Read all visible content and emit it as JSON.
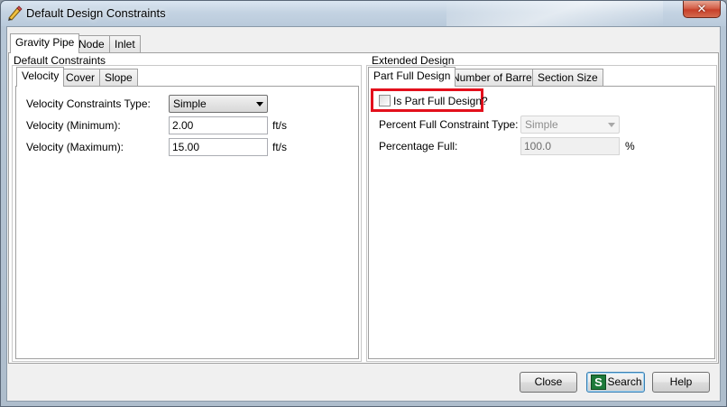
{
  "window": {
    "title": "Default Design Constraints",
    "close_glyph": "✕"
  },
  "top_tabs": [
    {
      "label": "Gravity Pipe",
      "active": true
    },
    {
      "label": "Node",
      "active": false
    },
    {
      "label": "Inlet",
      "active": false
    }
  ],
  "default_constraints": {
    "group_label": "Default Constraints",
    "tabs": [
      {
        "label": "Velocity",
        "active": true
      },
      {
        "label": "Cover",
        "active": false
      },
      {
        "label": "Slope",
        "active": false
      }
    ],
    "fields": {
      "type_label": "Velocity Constraints Type:",
      "type_value": "Simple",
      "min_label": "Velocity (Minimum):",
      "min_value": "2.00",
      "min_unit": "ft/s",
      "max_label": "Velocity (Maximum):",
      "max_value": "15.00",
      "max_unit": "ft/s"
    }
  },
  "extended_design": {
    "group_label": "Extended Design",
    "tabs": [
      {
        "label": "Part Full Design",
        "active": true
      },
      {
        "label": "Number of Barrels",
        "active": false
      },
      {
        "label": "Section Size",
        "active": false
      }
    ],
    "fields": {
      "is_part_full_label": "Is Part Full Design?",
      "is_part_full_checked": false,
      "percent_type_label": "Percent Full Constraint Type:",
      "percent_type_value": "Simple",
      "percentage_label": "Percentage Full:",
      "percentage_value": "100.0",
      "percentage_unit": "%"
    }
  },
  "footer": {
    "close_label": "Close",
    "search_label": "Search",
    "help_label": "Help"
  },
  "colors": {
    "highlight": "#e3101c",
    "search_icon": "#1d7a3a"
  },
  "icons": {
    "title": "pencil-icon",
    "search": "search-logo-icon"
  }
}
